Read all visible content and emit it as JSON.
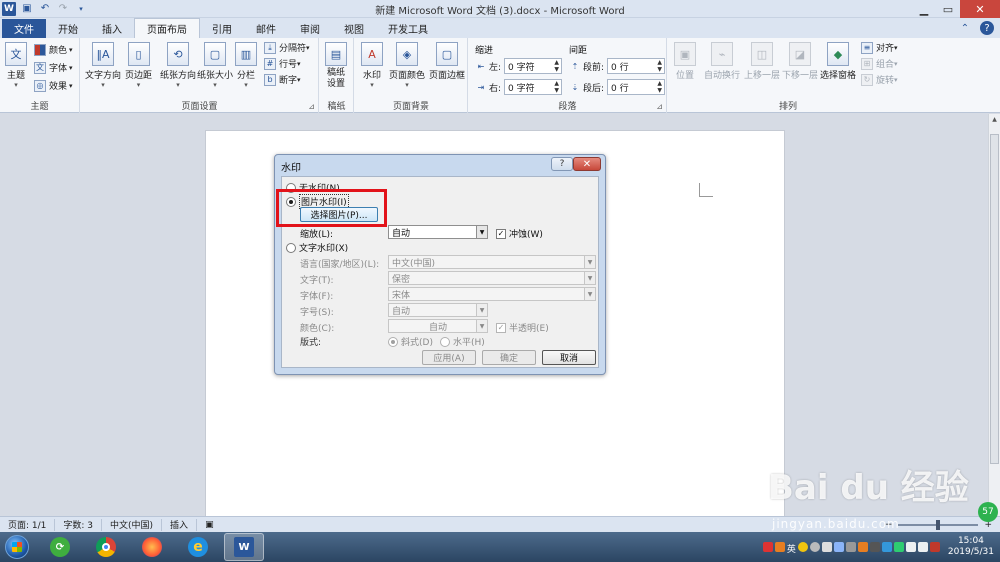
{
  "window": {
    "title": "新建 Microsoft Word 文档 (3).docx - Microsoft Word",
    "app_icon": "W"
  },
  "tabs": [
    {
      "label": "文件"
    },
    {
      "label": "开始"
    },
    {
      "label": "插入"
    },
    {
      "label": "页面布局"
    },
    {
      "label": "引用"
    },
    {
      "label": "邮件"
    },
    {
      "label": "审阅"
    },
    {
      "label": "视图"
    },
    {
      "label": "开发工具"
    }
  ],
  "ribbon": {
    "theme": {
      "label": "主题",
      "big": "主题",
      "colors": "颜色",
      "fonts": "字体",
      "effects": "效果"
    },
    "page_setup": {
      "label": "页面设置",
      "text_dir": "文字方向",
      "margins": "页边距",
      "orientation": "纸张方向",
      "size": "纸张大小",
      "columns": "分栏",
      "breaks": "分隔符",
      "line_numbers": "行号",
      "hyphenation": "断字"
    },
    "draft_paper": {
      "label": "稿纸",
      "btn": "稿纸\n设置"
    },
    "page_bg": {
      "label": "页面背景",
      "watermark": "水印",
      "page_color": "页面颜色",
      "page_borders": "页面边框"
    },
    "paragraph": {
      "label": "段落",
      "indent": "缩进",
      "spacing": "间距",
      "left_label": "左:",
      "right_label": "右:",
      "before_label": "段前:",
      "after_label": "段后:",
      "left_val": "0 字符",
      "right_val": "0 字符",
      "before_val": "0 行",
      "after_val": "0 行"
    },
    "arrange": {
      "label": "排列",
      "position": "位置",
      "wrap": "自动换行",
      "forward": "上移一层",
      "backward": "下移一层",
      "pane": "选择窗格",
      "align": "对齐",
      "group": "组合",
      "rotate": "旋转"
    }
  },
  "dialog": {
    "title": "水印",
    "help": "?",
    "close": "✕",
    "no_watermark": "无水印(N)",
    "picture_watermark": "图片水印(I)",
    "select_picture": "选择图片(P)...",
    "scale_label": "缩放(L):",
    "scale_value": "自动",
    "washout": "冲蚀(W)",
    "text_watermark": "文字水印(X)",
    "language_label": "语言(国家/地区)(L):",
    "language_value": "中文(中国)",
    "text_label": "文字(T):",
    "text_value": "保密",
    "font_label": "字体(F):",
    "font_value": "宋体",
    "size_label": "字号(S):",
    "size_value": "自动",
    "color_label": "颜色(C):",
    "color_value": "自动",
    "semitransparent": "半透明(E)",
    "layout_label": "版式:",
    "diagonal": "斜式(D)",
    "horizontal": "水平(H)",
    "apply": "应用(A)",
    "ok": "确定",
    "cancel": "取消"
  },
  "statusbar": {
    "page": "页面: 1/1",
    "words": "字数: 3",
    "lang": "中文(中国)",
    "insert": "插入"
  },
  "taskbar": {
    "time": "15:04",
    "date": "2019/5/31",
    "ime": "英"
  },
  "overlay": {
    "watermark_brand": "Bai du 经验",
    "watermark_url": "jingyan.baidu.com",
    "badge": "57"
  },
  "colors": {
    "accent": "#2b579a",
    "highlight": "#e2131a"
  }
}
